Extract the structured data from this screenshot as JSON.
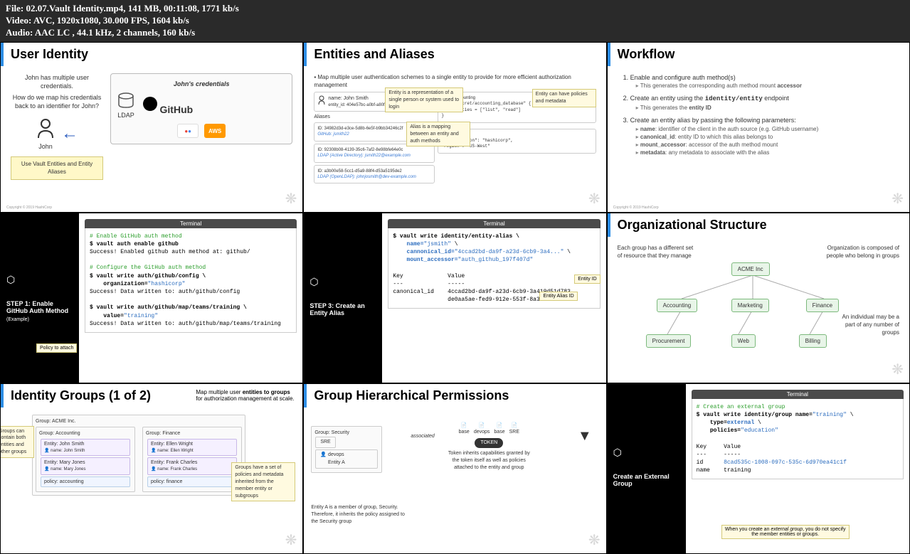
{
  "header": {
    "file": "File: 02.07.Vault Identity.mp4, 141 MB, 00:11:08, 1771 kb/s",
    "video": "Video: AVC, 1920x1080, 30.000 FPS, 1604 kb/s",
    "audio": "Audio: AAC LC , 44.1 kHz, 2 channels, 160 kb/s"
  },
  "slides": {
    "s1": {
      "title": "User Identity",
      "intro1": "John has multiple user credentials.",
      "intro2": "How do we map his credentials back to an identifier for John?",
      "john": "John",
      "credtitle": "John's credentials",
      "ldap": "LDAP",
      "github": "GitHub",
      "aws": "AWS",
      "usebox": "Use Vault Entities and Entity Aliases"
    },
    "s2": {
      "title": "Entities and Aliases",
      "bullet": "Map multiple user authentication schemes to a single entity to provide for more efficient authorization management",
      "name": "name: John Smith",
      "entityid": "entity_id: 404e57bc-a0bf-a80f-0a73-b6e98014c686",
      "aliases": "Aliases",
      "alias1": "ID: 34982d3d-e3ce-5d8b-6e5f-b9bb34246c2f",
      "alias1b": "GitHub: jsmith22",
      "alias2": "ID: 92308b08-4139-35c6-7af2-8e98bfe64e0c",
      "alias2b": "LDAP (Active Directory): jsmith22@example.com",
      "alias3": "ID: a3b00e58-5cc1-d5a9-88f4-d53a5195de2",
      "alias3b": "LDAP (OpenLDAP): johnjosmith@dev-example.com",
      "note1": "Entity is a representation of a single person or system used to login",
      "note2": "Alias is a mapping between an entity and auth methods",
      "note3": "Entity can have policies and metadata",
      "policy": "policy: accounting",
      "path": "path \"secret/accounting_database\" {",
      "caps": "  capabilities = [\"list\", \"read\"]",
      "meta": "metadata",
      "org": "\"organization\": \"hashicorp\",",
      "region": "\"region\": \"US-West\""
    },
    "s3": {
      "title": "Workflow",
      "item1": "Enable and configure auth method(s)",
      "item1a": "This generates the corresponding auth method mount accessor",
      "item2": "Create an entity using the identity/entity endpoint",
      "item2a": "This generates the entity ID",
      "item3": "Create an entity alias by passing the following parameters:",
      "item3a": "name: identifier of the client in the auth source (e.g. GitHub username)",
      "item3b": "canonical_id: entity ID to which this alias belongs to",
      "item3c": "mount_accessor: accessor of the auth method mount",
      "item3d": "metadata: any metadata to associate with the alias"
    },
    "s4": {
      "step": "STEP 1:  Enable GitHub Auth Method",
      "example": "(Example)",
      "terminal": "Terminal",
      "c1": "# Enable GitHub auth method",
      "l1": "$ vault auth enable github",
      "l2": "Success! Enabled github auth method at: github/",
      "c2": "# Configure the GitHub auth method",
      "l3": "$ vault write auth/github/config \\",
      "l4": "    organization=\"hashicorp\"",
      "l5": "Success! Data written to: auth/github/config",
      "l6": "$ vault write auth/github/map/teams/training \\",
      "l7": "    value=\"training\"",
      "l8": "Success! Data written to: auth/github/map/teams/training",
      "policylabel": "Policy to attach"
    },
    "s5": {
      "step": "STEP 3: Create an Entity Alias",
      "terminal": "Terminal",
      "l1": "$ vault write identity/entity-alias \\",
      "l2": "    name=\"jsmith\" \\",
      "l3": "    cannonical_id=\"4ccad2bd-da9f-a23d-6cb9-3a4...\" \\",
      "l4": "    mount_accessor=\"auth_github_197f407d\"",
      "hkey": "Key",
      "hval": "Value",
      "d1": "---",
      "d2": "-----",
      "r1k": "canonical_id",
      "r1v": "4ccad2bd-da9f-a23d-6cb9-3a419d51d783",
      "r2v": "de0aa5ae-fed9-912e-553f-8a3c2f03a69a",
      "entityid": "Entity ID",
      "aliasid": "Entity Alias ID"
    },
    "s6": {
      "title": "Organizational Structure",
      "left": "Each group has a different set of resource that they manage",
      "right": "Organization is composed of people who belong in groups",
      "bottomright": "An individual may be a part of any number of groups",
      "acme": "ACME Inc",
      "acct": "Accounting",
      "mktg": "Marketing",
      "fin": "Finance",
      "proc": "Procurement",
      "web": "Web",
      "bill": "Billing"
    },
    "s7": {
      "title": "Identity Groups (1 of 2)",
      "subtitle": "Map multiple user entities to groups for authorization management at scale.",
      "top": "Group: ACME Inc.",
      "g1": "Group: Accounting",
      "g2": "Group: Finance",
      "e1": "Entity: John Smith",
      "e1n": "name: John Smith",
      "e2": "Entity: Mary Jones",
      "e2n": "name: Mary Jones",
      "e3": "Entity: Ellen Wright",
      "e3n": "name: Ellen Wright",
      "e4": "Entity: Frank Charles",
      "e4n": "name: Frank Charles",
      "p1": "policy: accounting",
      "p2": "policy: finance",
      "note1": "Groups can contain both entities and other groups",
      "note2": "Groups have a set of policies and metadata inherited from the member entity or subgroups"
    },
    "s8": {
      "title": "Group Hierarchical Permissions",
      "grp": "Group: Security",
      "sre": "SRE",
      "devops": "devops",
      "base": "base",
      "assoc": "associated",
      "entitya": "Entity A",
      "token": "TOKEN",
      "tokentxt": "Token inherits capabilities granted by the token itself as well as policies attached to the entity and group",
      "bottom": "Entity A is a member of group, Security. Therefore, it inherits the policy assigned to the Security group"
    },
    "s9": {
      "step": "Create an External Group",
      "terminal": "Terminal",
      "c1": "# Create an external group",
      "l1": "$ vault write identity/group name=\"training\" \\",
      "l2": "    type=external \\",
      "l3": "    policies=\"education\"",
      "hkey": "Key",
      "hval": "Value",
      "d1": "---",
      "d2": "-----",
      "rid": "id",
      "ridv": "8cad535c-1008-097c-535c-6d970ea41c1f",
      "rname": "name",
      "rnamev": "training",
      "note": "When you create an external group, you do not specify the member entities or groups."
    }
  },
  "copyright": "Copyright © 2019 HashiCorp"
}
